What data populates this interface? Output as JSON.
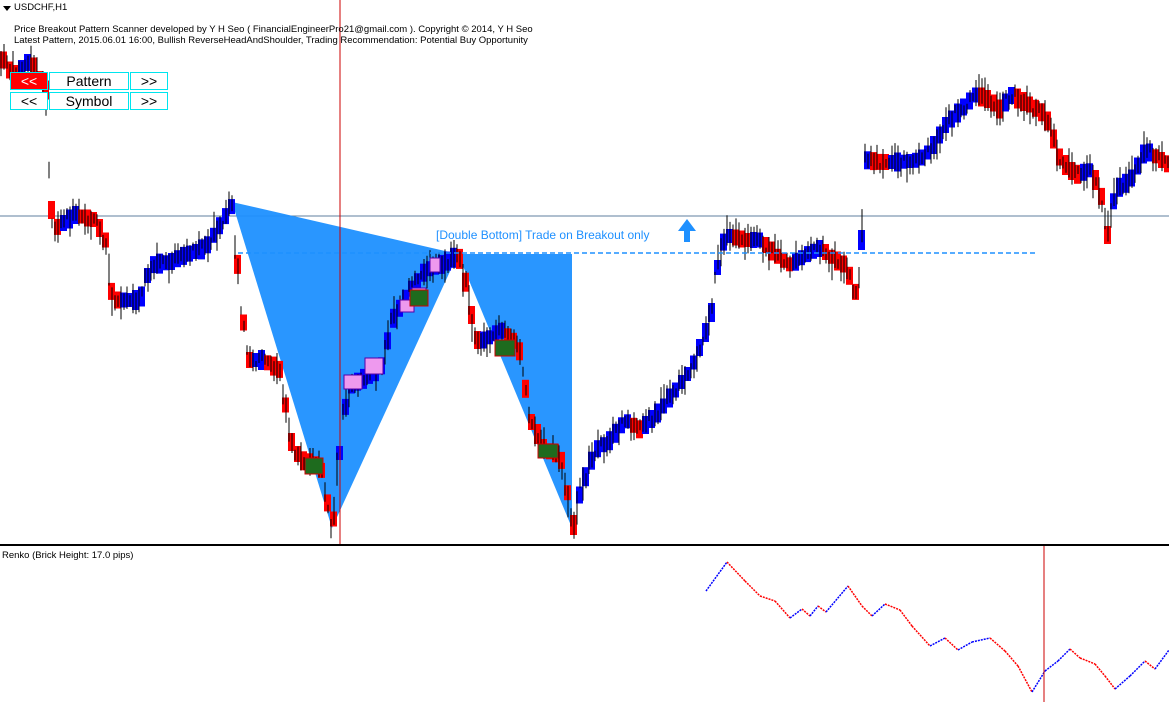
{
  "chart": {
    "symbol_title": "USDCHF,H1",
    "info_line_1": "Price Breakout Pattern Scanner developed by Y H Seo ( FinancialEngineerPro21@gmail.com ). Copyright © 2014, Y H Seo",
    "info_line_2": "Latest Pattern, 2015.06.01 16:00, Bullish ReverseHeadAndShoulder, Trading Recommendation: Potential Buy Opportunity",
    "trade_label": "[Double Bottom] Trade on Breakout only",
    "colors": {
      "bull": "#0000ff",
      "bear": "#ff0000",
      "pattern_fill": "#1e90ff",
      "breakout_line": "#1e90ff",
      "cursor_line": "#cc0000",
      "highlight_box": "#ee99ee",
      "green_box": "#1e6b1e"
    }
  },
  "controls": {
    "pattern_prev": "<<",
    "pattern_label": "Pattern",
    "pattern_next": ">>",
    "symbol_prev": "<<",
    "symbol_label": "Symbol",
    "symbol_next": ">>"
  },
  "renko": {
    "label": "Renko (Brick Height: 17.0 pips)",
    "colors": {
      "up": "#0000ff",
      "down": "#ff0000"
    }
  },
  "icons": {
    "breakout_arrow": "arrow-up-icon",
    "symbol_menu": "triangle-down-icon"
  }
}
